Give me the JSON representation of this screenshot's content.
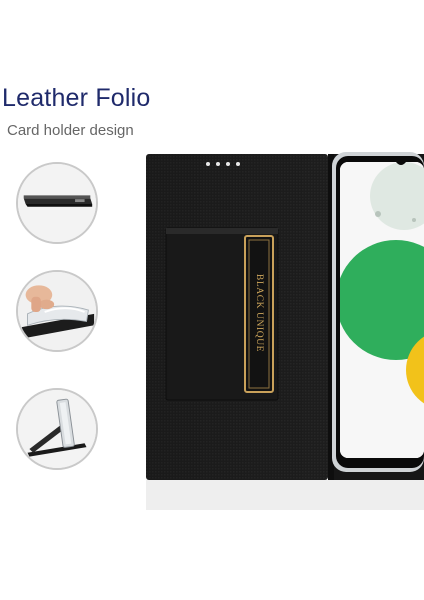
{
  "heading": {
    "title": "Leather Folio",
    "subtitle": "Card holder design"
  },
  "card_holder": {
    "brand_label": "BLACK UNIQUE"
  },
  "features": [
    {
      "icon": "case-edge-icon"
    },
    {
      "icon": "flexible-tpu-icon"
    },
    {
      "icon": "kickstand-icon"
    }
  ],
  "colors": {
    "title": "#1f2a6b",
    "leather": "#1b1b1b",
    "gold_trim": "#c9a15a",
    "screen_green": "#2fae5c"
  }
}
